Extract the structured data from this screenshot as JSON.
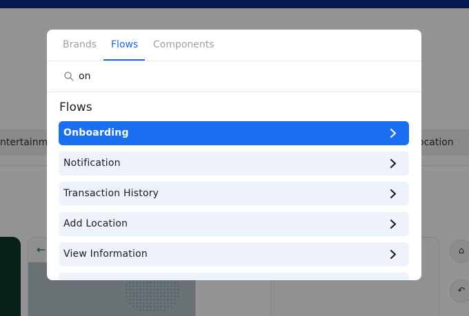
{
  "background": {
    "chip_left": "ntertainme",
    "chip_right": "ocation",
    "card_back_arrow": "←",
    "side_button_1": "⌂",
    "side_button_2": "↶"
  },
  "modal": {
    "tabs": [
      {
        "label": "Brands",
        "active": false
      },
      {
        "label": "Flows",
        "active": true
      },
      {
        "label": "Components",
        "active": false
      }
    ],
    "search": {
      "value": "on",
      "icon": "search-icon"
    },
    "section_title": "Flows",
    "items": [
      {
        "label": "Onboarding",
        "selected": true
      },
      {
        "label": "Notification",
        "selected": false
      },
      {
        "label": "Transaction History",
        "selected": false
      },
      {
        "label": "Add Location",
        "selected": false
      },
      {
        "label": "View Information",
        "selected": false
      },
      {
        "label": "",
        "selected": false
      }
    ]
  },
  "colors": {
    "accent": "#1a66e8",
    "selected_row": "#1a6ef0",
    "row_bg": "#eef2fb",
    "topbar": "#0a2a8a"
  }
}
